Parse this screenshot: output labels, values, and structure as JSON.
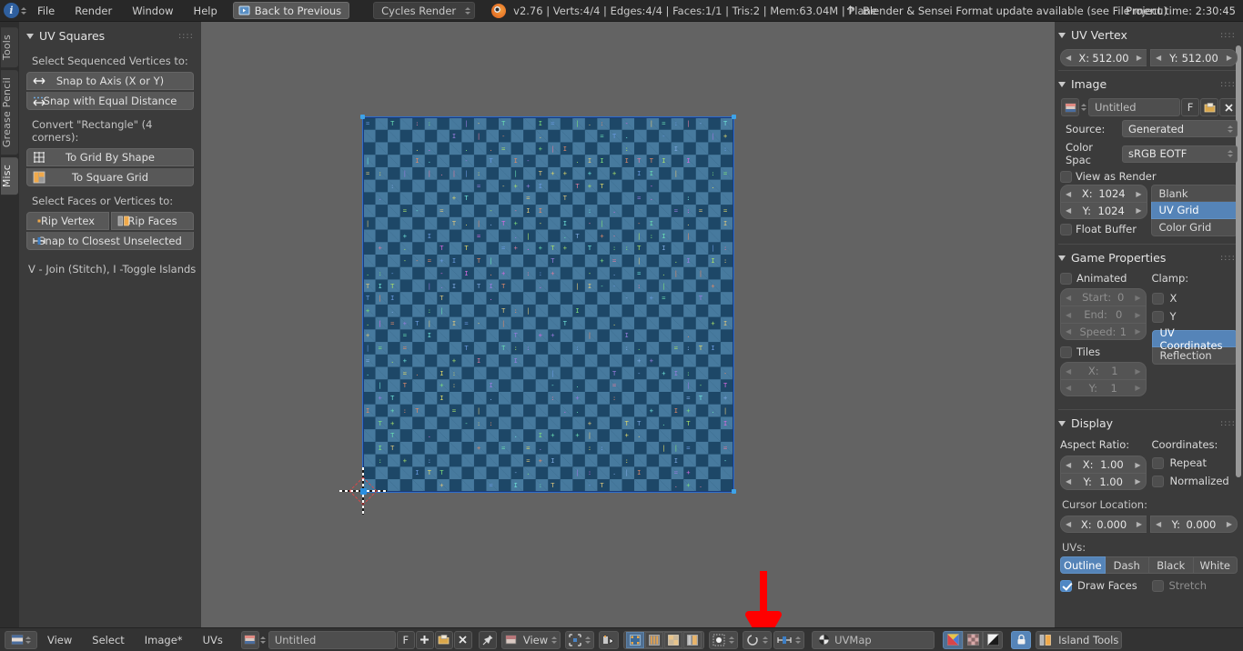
{
  "topbar": {
    "menus": [
      "File",
      "Render",
      "Window",
      "Help"
    ],
    "back_button": "Back to Previous",
    "engine": "Cycles Render",
    "stats": "v2.76 | Verts:4/4 | Edges:4/4 | Faces:1/1 | Tris:2 | Mem:63.04M | Plane",
    "update_note": "Blender & Sensei Format update available (see File menu)",
    "project_time": "Project time: 2:30:45"
  },
  "left": {
    "tabs": [
      {
        "label": "Tools",
        "active": false
      },
      {
        "label": "Grease Pencil",
        "active": false
      },
      {
        "label": "Misc",
        "active": true
      }
    ],
    "panel_title": "UV Squares",
    "section1_label": "Select Sequenced Vertices to:",
    "buttons1": [
      {
        "label": "Snap to Axis (X or Y)",
        "icon": "arrows-horizontal-icon"
      },
      {
        "label": "Snap with Equal Distance",
        "icon": "arrows-equal-distance-icon"
      }
    ],
    "section2_label": "Convert \"Rectangle\" (4 corners):",
    "buttons2": [
      {
        "label": "To Grid By Shape",
        "icon": "grid-shape-icon"
      },
      {
        "label": "To Square Grid",
        "icon": "square-grid-icon"
      }
    ],
    "section3_label": "Select Faces or Vertices to:",
    "buttons3": [
      {
        "label": "Rip Vertex",
        "icon": "rip-vertex-icon"
      },
      {
        "label": "Rip Faces",
        "icon": "rip-faces-icon"
      }
    ],
    "button4": {
      "label": "Snap to Closest Unselected",
      "icon": "snap-closest-icon"
    },
    "hint": "V - Join (Stitch), I -Toggle Islands"
  },
  "right": {
    "uv_vertex": {
      "title": "UV Vertex",
      "x_label": "X:",
      "x_value": "512.00",
      "y_label": "Y:",
      "y_value": "512.00"
    },
    "image": {
      "title": "Image",
      "name": "Untitled",
      "fake_user": "F",
      "source_label": "Source:",
      "source_value": "Generated",
      "colorspace_label": "Color Spac",
      "colorspace_value": "sRGB EOTF",
      "view_as_render": "View as Render",
      "x_label": "X:",
      "x_value": "1024",
      "y_label": "Y:",
      "y_value": "1024",
      "float_buffer": "Float Buffer",
      "generated_types": [
        {
          "label": "Blank",
          "selected": false
        },
        {
          "label": "UV Grid",
          "selected": true
        },
        {
          "label": "Color Grid",
          "selected": false
        }
      ]
    },
    "game": {
      "title": "Game Properties",
      "animated": "Animated",
      "clamp_label": "Clamp:",
      "clamp_x": "X",
      "clamp_y": "Y",
      "start_label": "Start:",
      "start_value": "0",
      "end_label": "End:",
      "end_value": "0",
      "speed_label": "Speed:",
      "speed_value": "1",
      "tiles": "Tiles",
      "tiles_x_label": "X:",
      "tiles_x_value": "1",
      "tiles_y_label": "Y:",
      "tiles_y_value": "1",
      "mapping": [
        {
          "label": "UV Coordinates",
          "selected": true
        },
        {
          "label": "Reflection",
          "selected": false
        }
      ]
    },
    "display": {
      "title": "Display",
      "aspect_label": "Aspect Ratio:",
      "aspect_x_label": "X:",
      "aspect_x_value": "1.00",
      "aspect_y_label": "Y:",
      "aspect_y_value": "1.00",
      "coords_label": "Coordinates:",
      "repeat": "Repeat",
      "normalized": "Normalized",
      "cursor_label": "Cursor Location:",
      "cursor_x_label": "X:",
      "cursor_x_value": "0.000",
      "cursor_y_label": "Y:",
      "cursor_y_value": "0.000",
      "uvs_label": "UVs:",
      "uv_styles": [
        {
          "label": "Outline",
          "selected": true
        },
        {
          "label": "Dash",
          "selected": false
        },
        {
          "label": "Black",
          "selected": false
        },
        {
          "label": "White",
          "selected": false
        }
      ],
      "draw_faces": "Draw Faces",
      "draw_faces_on": true,
      "stretch": "Stretch",
      "stretch_on": false
    }
  },
  "bottombar": {
    "menus": [
      "View",
      "Select",
      "Image*",
      "UVs"
    ],
    "image_name": "Untitled",
    "fake_user": "F",
    "view_label": "View",
    "uvmap_label": "UVMap",
    "island_tools_label": "Island Tools",
    "icons": [
      "editor-type-icon",
      "new-image-icon",
      "open-image-icon",
      "unlink-image-icon",
      "pin-icon",
      "view-mode-icon",
      "pivot-icon",
      "snap-icon",
      "select-vertex-icon",
      "select-edge-icon",
      "select-face-icon",
      "select-island-icon",
      "uv-sync-icon",
      "proportional-edit-icon",
      "snap-magnet-icon",
      "snap-target-icon",
      "uv-channel-icon",
      "draw-type-uv-icon",
      "draw-type-alpha-icon",
      "draw-type-bw-icon",
      "lock-icon",
      "island-tools-icon"
    ]
  },
  "viewport": {
    "grid_type": "uv-grid-checker",
    "checker_colors": [
      "#477a9e",
      "#1d4767"
    ],
    "selection_color": "#2f6fc9",
    "cursor_color": "#2a8fe0",
    "annotation_arrow_color": "#ff0000"
  }
}
